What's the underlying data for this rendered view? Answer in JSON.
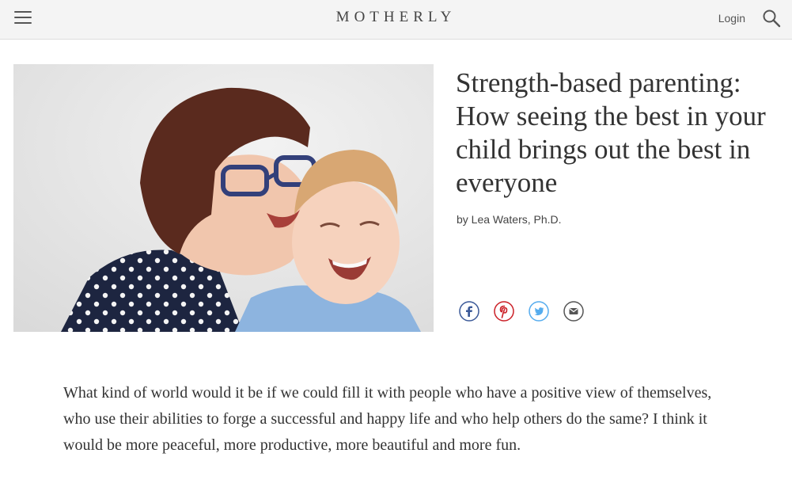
{
  "header": {
    "logo": "MOTHERLY",
    "login_label": "Login"
  },
  "article": {
    "title": "Strength-based parenting: How seeing the best in your child brings out the best in everyone",
    "byline": "by Lea Waters, Ph.D.",
    "intro": "What kind of world would it be if we could fill it with people who have a positive view of themselves, who use their abilities to forge a successful and happy life and who help others do the same? I think it would be more peaceful, more productive, more beautiful and more fun."
  },
  "share": [
    {
      "icon": "facebook-icon",
      "color": "#3b5998"
    },
    {
      "icon": "pinterest-icon",
      "color": "#cb2027"
    },
    {
      "icon": "twitter-icon",
      "color": "#55acee"
    },
    {
      "icon": "email-icon",
      "color": "#555555"
    }
  ],
  "colors": {
    "header_bg": "#f4f4f4",
    "text": "#333333"
  }
}
